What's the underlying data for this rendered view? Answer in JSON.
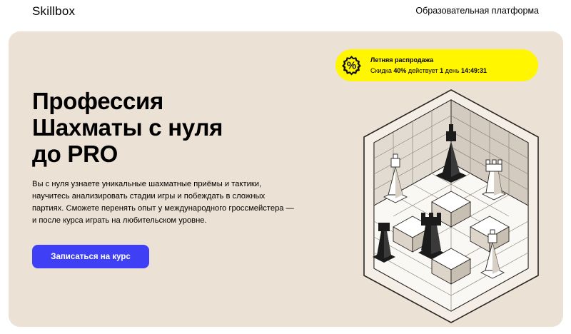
{
  "header": {
    "logo": "Skillbox",
    "platform_link": "Образовательная платформа"
  },
  "sale": {
    "icon": "percent-badge-icon",
    "title": "Летняя распродажа",
    "prefix": "Скидка ",
    "discount": "40%",
    "middle": " действует ",
    "days_count": "1",
    "days_word": " день ",
    "timer": "14:49:31"
  },
  "hero": {
    "title_lines": [
      "Профессия",
      "Шахматы с нуля",
      "до PRO"
    ],
    "description": "Вы с нуля узнаете уникальные шахматные приёмы и тактики, научитесь анализировать стадии игры и побеждать в сложных партиях. Сможете перенять опыт у международного гроссмейстера — и после курса играть на любительском уровне.",
    "cta_label": "Записаться на курс"
  },
  "illustration": {
    "name": "isometric-chessboard",
    "pieces": [
      "black-king",
      "white-bishop",
      "white-rook",
      "black-pawn",
      "black-rook",
      "white-bishop"
    ]
  },
  "colors": {
    "hero_bg": "#ebe1d5",
    "sale_bg": "#fff600",
    "cta_bg": "#3f3ff5"
  }
}
